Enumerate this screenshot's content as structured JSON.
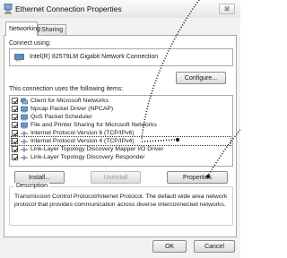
{
  "window": {
    "title": "Ethernet Connection Properties",
    "close": "⊠"
  },
  "tabs": [
    {
      "label": "Networking"
    },
    {
      "label": "Sharing"
    }
  ],
  "connect": {
    "label": "Connect using:",
    "adapter": "Intel(R) 82579LM Gigabit Network Connection",
    "configure_label": "Configure..."
  },
  "items_label": "This connection uses the following items:",
  "items": [
    {
      "label": "Client for Microsoft Networks",
      "icon": "network-client-icon"
    },
    {
      "label": "Npcap Packet Driver (NPCAP)",
      "icon": "network-service-icon"
    },
    {
      "label": "QoS Packet Scheduler",
      "icon": "network-service-icon"
    },
    {
      "label": "File and Printer Sharing for Microsoft Networks",
      "icon": "network-service-icon"
    },
    {
      "label": "Internet Protocol Version 6 (TCP/IPv6)",
      "icon": "protocol-icon"
    },
    {
      "label": "Internet Protocol Version 4 (TCP/IPv4)",
      "icon": "protocol-icon"
    },
    {
      "label": "Link-Layer Topology Discovery Mapper I/O Driver",
      "icon": "protocol-icon"
    },
    {
      "label": "Link-Layer Topology Discovery Responder",
      "icon": "protocol-icon"
    }
  ],
  "buttons": {
    "install": "Install...",
    "uninstall": "Uninstall",
    "properties": "Properties",
    "ok": "OK",
    "cancel": "Cancel"
  },
  "description": {
    "title": "Description",
    "text": "Transmission Control Protocol/Internet Protocol. The default wide area network protocol that provides communication across diverse interconnected networks."
  },
  "colors": {
    "accent": "#2d6fd0",
    "protocol_line": "#7a5a32",
    "annotation_dots": "#111111"
  }
}
